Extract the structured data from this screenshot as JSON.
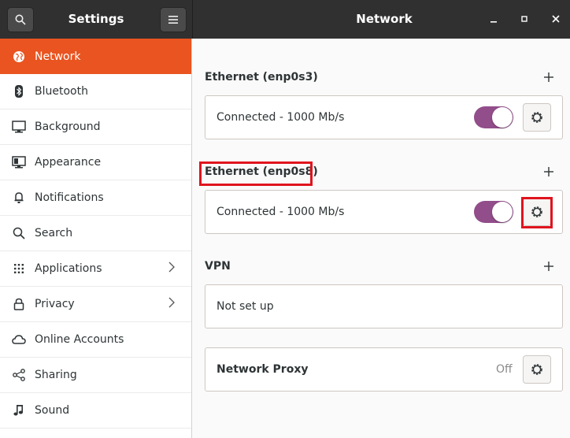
{
  "header": {
    "left_title": "Settings",
    "right_title": "Network",
    "search_icon": "search-icon",
    "menu_icon": "hamburger-icon"
  },
  "sidebar": {
    "items": [
      {
        "label": "Network",
        "icon": "network-icon",
        "active": true,
        "chevron": false
      },
      {
        "label": "Bluetooth",
        "icon": "bluetooth-icon",
        "active": false,
        "chevron": false
      },
      {
        "label": "Background",
        "icon": "background-icon",
        "active": false,
        "chevron": false
      },
      {
        "label": "Appearance",
        "icon": "appearance-icon",
        "active": false,
        "chevron": false
      },
      {
        "label": "Notifications",
        "icon": "bell-icon",
        "active": false,
        "chevron": false
      },
      {
        "label": "Search",
        "icon": "search-icon",
        "active": false,
        "chevron": false
      },
      {
        "label": "Applications",
        "icon": "grid-icon",
        "active": false,
        "chevron": true
      },
      {
        "label": "Privacy",
        "icon": "lock-icon",
        "active": false,
        "chevron": true
      },
      {
        "label": "Online Accounts",
        "icon": "cloud-icon",
        "active": false,
        "chevron": false
      },
      {
        "label": "Sharing",
        "icon": "share-icon",
        "active": false,
        "chevron": false
      },
      {
        "label": "Sound",
        "icon": "music-note-icon",
        "active": false,
        "chevron": false
      }
    ]
  },
  "main": {
    "ethernet1": {
      "heading": "Ethernet (enp0s3)",
      "status": "Connected - 1000 Mb/s",
      "enabled": true
    },
    "ethernet2": {
      "heading": "Ethernet (enp0s8)",
      "status": "Connected - 1000 Mb/s",
      "enabled": true
    },
    "vpn": {
      "heading": "VPN",
      "status": "Not set up"
    },
    "proxy": {
      "label": "Network Proxy",
      "state": "Off"
    }
  },
  "colors": {
    "accent": "#e95420",
    "toggle_on": "#924d8b",
    "highlight": "#e0141e",
    "titlebar": "#303030"
  }
}
